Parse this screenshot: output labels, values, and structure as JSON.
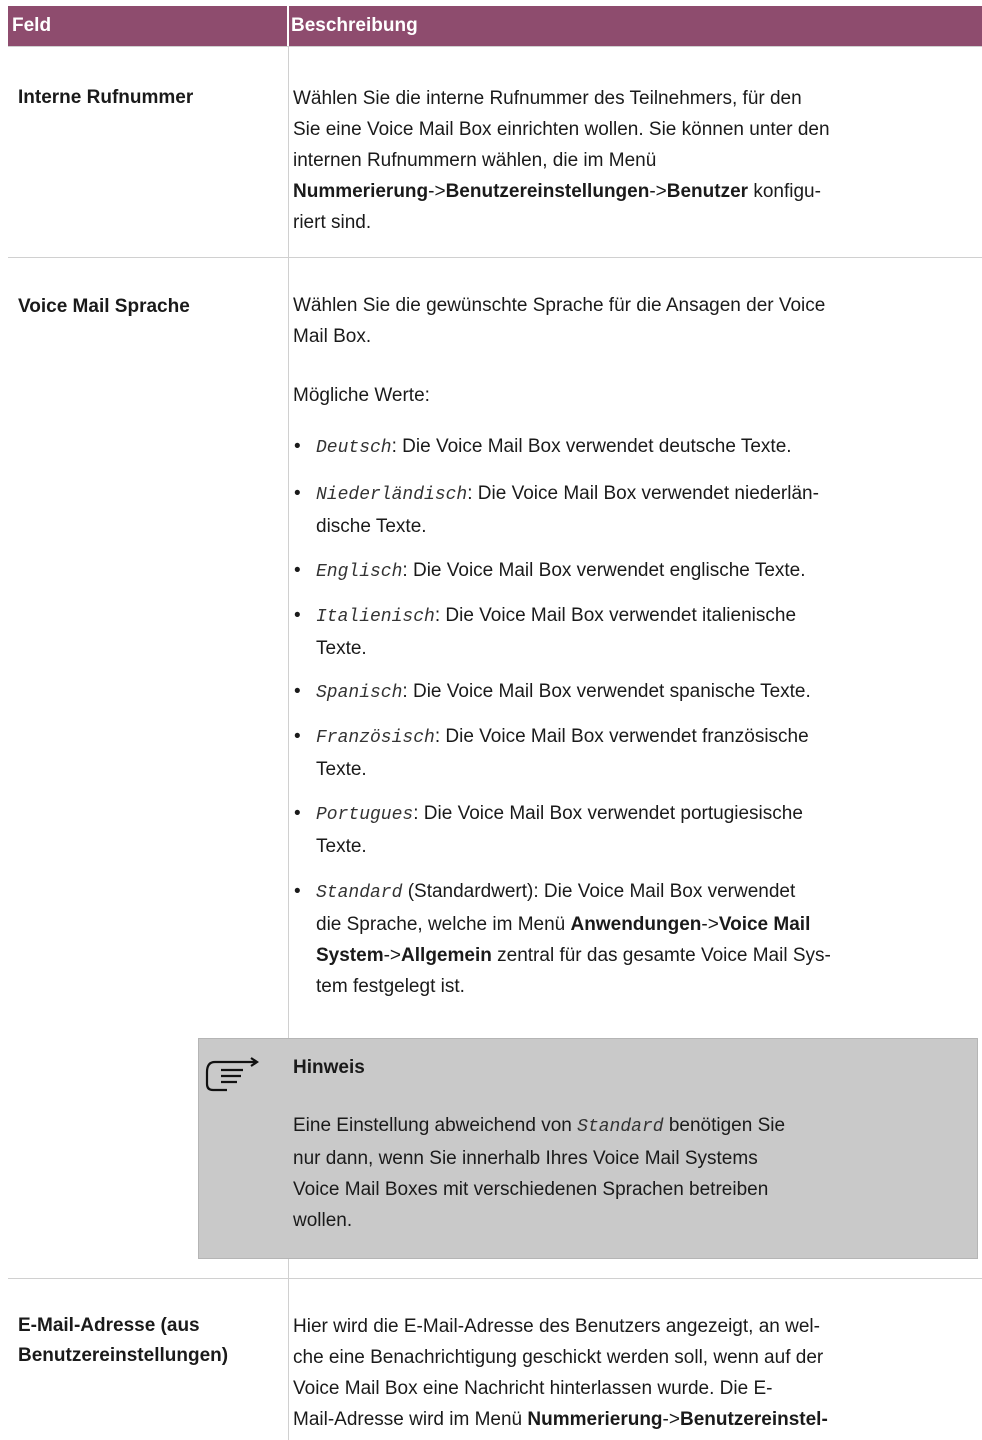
{
  "table": {
    "header": {
      "field": "Feld",
      "description": "Beschreibung"
    },
    "rows": {
      "interne": {
        "field": "Interne Rufnummer",
        "desc_1": "Wählen Sie die interne Rufnummer des Teilnehmers, für den",
        "desc_2": "Sie eine Voice Mail Box einrichten wollen. Sie können unter den",
        "desc_3": "internen Rufnummern wählen, die im Menü",
        "menu_1": "Nummerierung",
        "sep_1": "->",
        "menu_2": "Benutzereinstellungen",
        "sep_2": "->",
        "menu_3": "Benutzer",
        "desc_4": " konfigu-",
        "desc_5": "riert sind."
      },
      "sprache": {
        "field": "Voice Mail Sprache",
        "desc_1": "Wählen Sie die gewünschte Sprache für die Ansagen der Voice",
        "desc_2": "Mail Box.",
        "possible": "Mögliche Werte:",
        "values": [
          {
            "code": "Deutsch",
            "text_1": ": Die Voice Mail Box verwendet deutsche Texte.",
            "text_2": ""
          },
          {
            "code": "Niederländisch",
            "text_1": ": Die Voice Mail Box verwendet niederlän-",
            "text_2": "dische Texte."
          },
          {
            "code": "Englisch",
            "text_1": ": Die Voice Mail Box verwendet englische Texte.",
            "text_2": ""
          },
          {
            "code": "Italienisch",
            "text_1": ": Die Voice Mail Box verwendet italienische",
            "text_2": "Texte."
          },
          {
            "code": "Spanisch",
            "text_1": ": Die Voice Mail Box verwendet spanische Texte.",
            "text_2": ""
          },
          {
            "code": "Französisch",
            "text_1": ": Die Voice Mail Box verwendet französische",
            "text_2": "Texte."
          },
          {
            "code": "Portugues",
            "text_1": ": Die Voice Mail Box verwendet portugiesische",
            "text_2": "Texte."
          }
        ],
        "standard": {
          "code": "Standard",
          "text_1": " (Standardwert): Die Voice Mail Box verwendet",
          "text_2": "die Sprache, welche im Menü ",
          "menu_1": "Anwendungen",
          "sep_1": "->",
          "menu_2a": "Voice Mail",
          "menu_2b": "System",
          "sep_2": "->",
          "menu_3": "Allgemein",
          "text_3": " zentral für das gesamte Voice Mail Sys-",
          "text_4": "tem festgelegt ist."
        }
      },
      "email": {
        "field_1": "E-Mail-Adresse (aus",
        "field_2": "Benutzereinstellungen)",
        "desc_1": "Hier wird die E-Mail-Adresse des Benutzers angezeigt, an wel-",
        "desc_2": "che eine Benachrichtigung geschickt werden soll, wenn auf der",
        "desc_3": "Voice Mail Box eine Nachricht hinterlassen wurde. Die E-",
        "desc_4": "Mail-Adresse wird im Menü ",
        "menu_1": "Nummerierung",
        "sep_1": "->",
        "menu_2": "Benutzereinstel-"
      }
    }
  },
  "note": {
    "title": "Hinweis",
    "line_1a": "Eine Einstellung abweichend von ",
    "code": "Standard",
    "line_1b": " benötigen Sie",
    "line_2": "nur dann, wenn Sie innerhalb Ihres Voice Mail Systems",
    "line_3": "Voice Mail Boxes mit verschiedenen Sprachen betreiben",
    "line_4": "wollen."
  },
  "icons": {
    "note": "pointing-hand-icon",
    "bullet": "bullet-icon"
  },
  "colors": {
    "header_bg": "#8e4c6e",
    "note_bg": "#c9c9c9"
  }
}
